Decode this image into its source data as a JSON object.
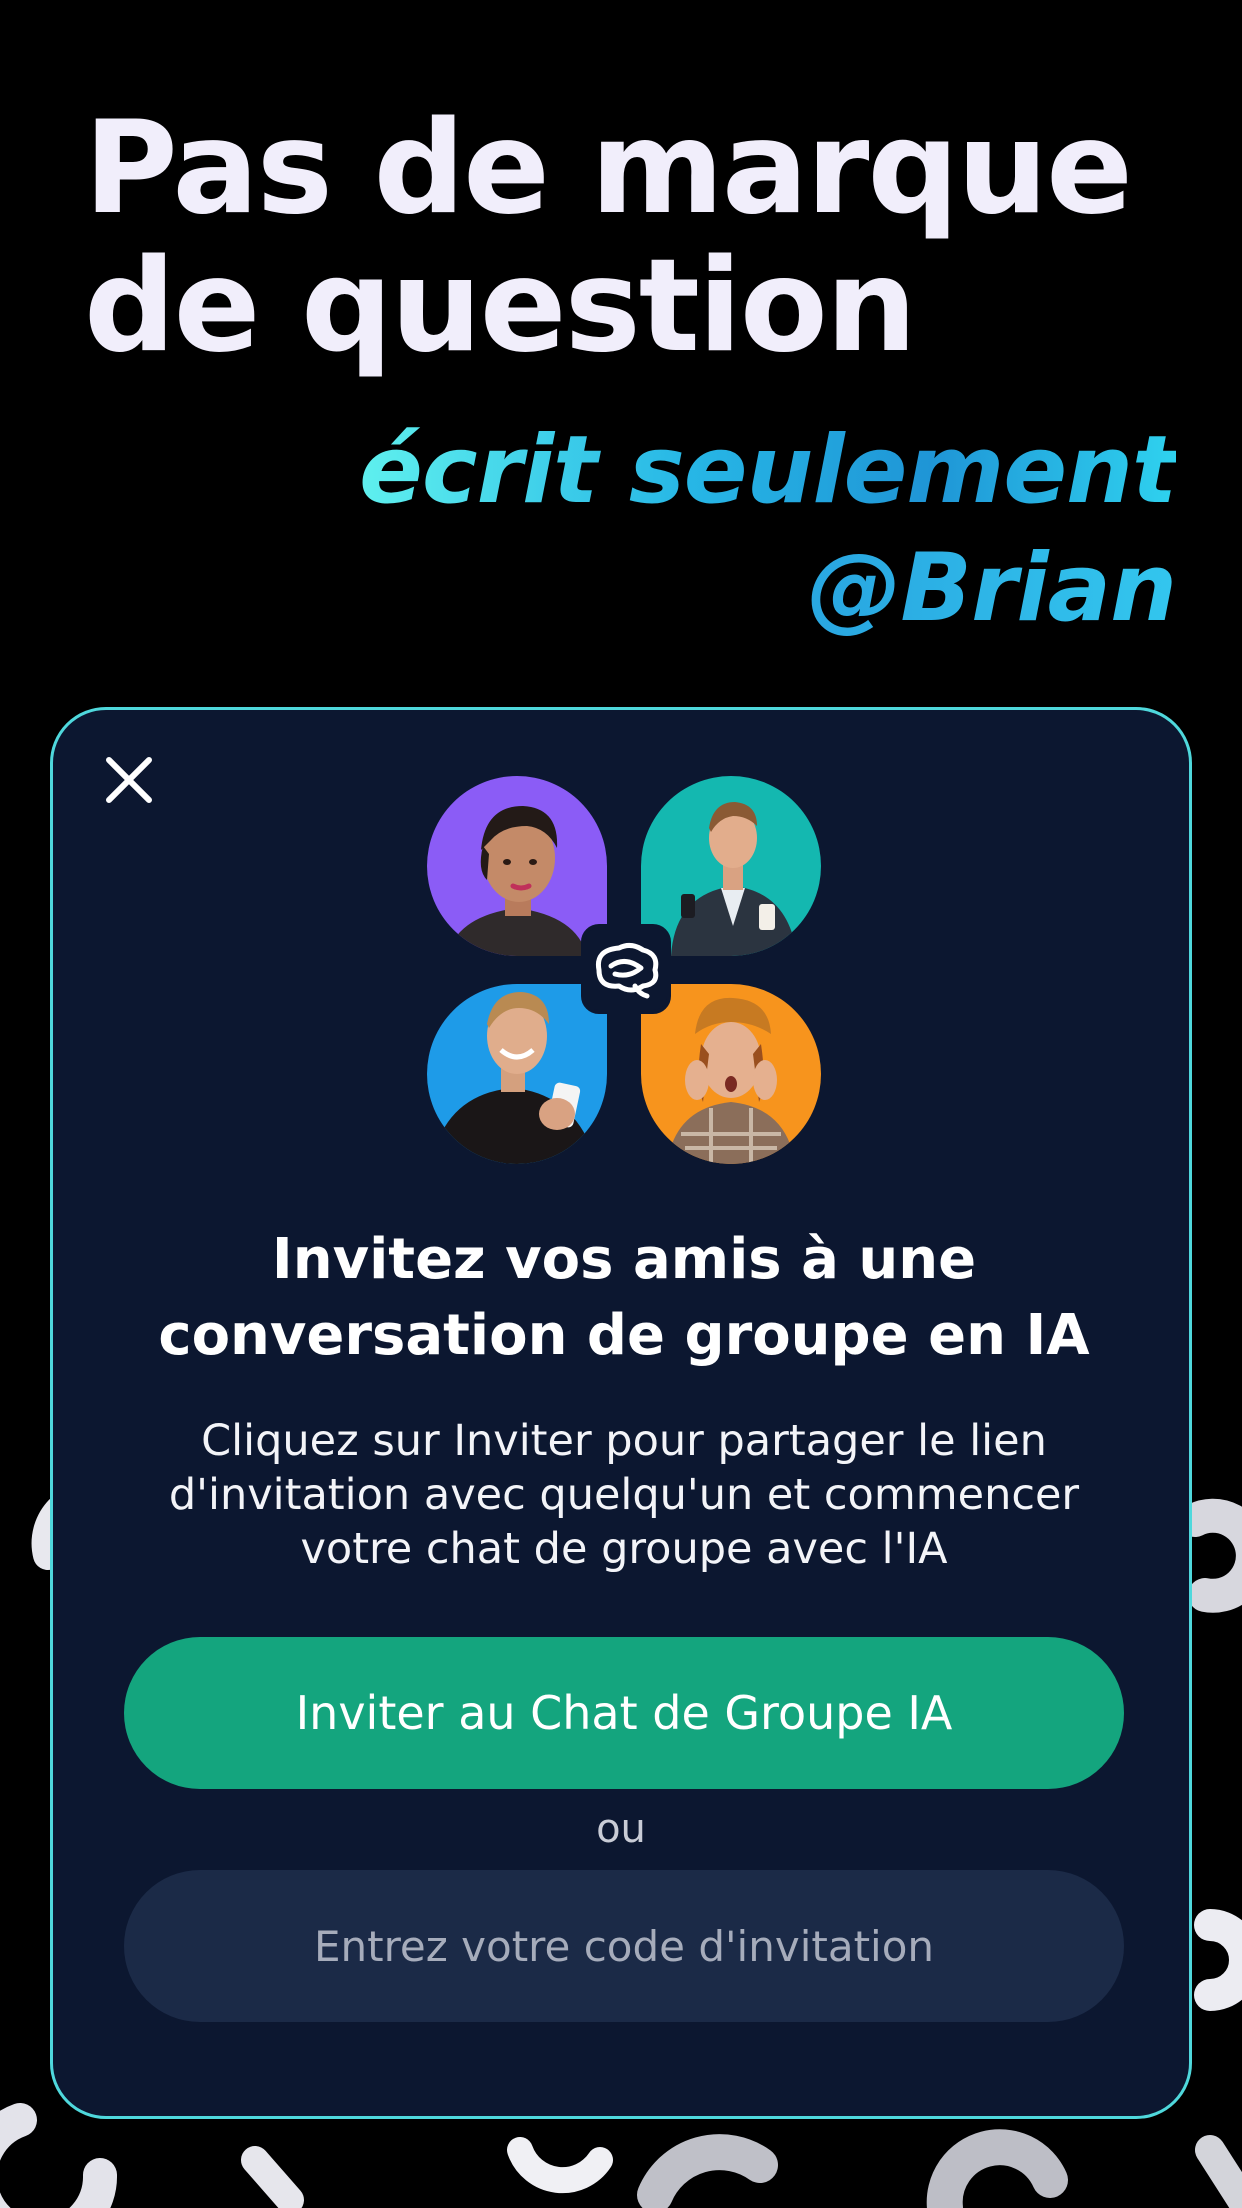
{
  "headline": {
    "line1": "Pas de marque",
    "line2": "de question"
  },
  "accent": {
    "line1": "écrit seulement",
    "line2": "@Brian"
  },
  "modal": {
    "close_icon": "close-icon",
    "logo_icon": "brain-logo-icon",
    "title": "Invitez vos amis à une\nconversation de groupe en IA",
    "description": "Cliquez sur Inviter pour partager le lien\nd'invitation avec quelqu'un et commencer\nvotre chat de groupe avec l'IA",
    "invite_button": "Inviter au Chat de Groupe IA",
    "or_label": "ou",
    "code_placeholder": "Entrez votre code d'invitation",
    "code_value": ""
  },
  "colors": {
    "background": "#000000",
    "modal_bg": "#0c1730",
    "modal_border": "#4fd8dc",
    "accent_gradient_start": "#5ff0ee",
    "accent_gradient_end": "#1f95d6",
    "invite_button": "#14a57e",
    "code_input_bg": "#1b2a47",
    "avatar_purple": "#8b5cf6",
    "avatar_teal": "#14b8b0",
    "avatar_blue": "#1e9be8",
    "avatar_orange": "#f7941d"
  }
}
